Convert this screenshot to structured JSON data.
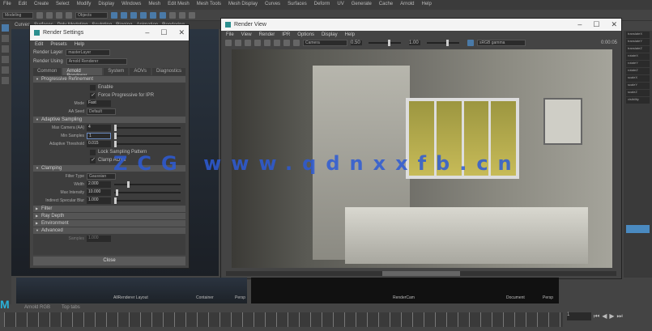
{
  "menubar": [
    "File",
    "Edit",
    "Create",
    "Select",
    "Modify",
    "Display",
    "Windows",
    "Mesh",
    "Edit Mesh",
    "Mesh Tools",
    "Mesh Display",
    "Curves",
    "Surfaces",
    "Deform",
    "UV",
    "Generate",
    "Cache",
    "Arnold",
    "Help"
  ],
  "workspace": "Modeling",
  "search": "Objects",
  "shelf_tabs": [
    "Curves",
    "Surfaces",
    "Poly Modeling",
    "Sculpting",
    "Rigging",
    "Animation",
    "Rendering"
  ],
  "render_settings": {
    "title": "Render Settings",
    "menu": [
      "Edit",
      "Presets",
      "Help"
    ],
    "render_layer_label": "Render Layer",
    "render_layer": "masterLayer",
    "render_using_label": "Render Using",
    "render_using": "Arnold Renderer",
    "tabs": [
      "Common",
      "Arnold Renderer",
      "System",
      "AOVs",
      "Diagnostics"
    ],
    "active_tab": 1,
    "sections": {
      "progressive": "Progressive Refinement",
      "adaptive": "Adaptive Sampling",
      "clamping": "Clamping",
      "filter": "Filter",
      "advanced": "Advanced",
      "ray_depth": "Ray Depth",
      "environment": "Environment"
    },
    "fields": {
      "enable": "Enable",
      "progressive": "Force Progressive for IPR",
      "mode": "Mode",
      "mode_val": "Fast",
      "aa_pattern": "AA Seed",
      "aa_pattern_val": "Default",
      "max_camera": "Max Camera (AA)",
      "max_camera_val": "4",
      "adaptive_threshold": "Adaptive Threshold",
      "adaptive_threshold_val": "0.015",
      "min_samples": "Min Samples",
      "min_samples_val": "1",
      "lock_sampling": "Lock Sampling Pattern",
      "clamp_aovs": "Clamp AOVs",
      "filter_type": "Filter Type",
      "filter_type_val": "Gaussian",
      "width": "Width",
      "width_val": "2.000",
      "max_intensity": "Max Intensity",
      "max_intensity_val": "10.000",
      "indirect_specular": "Indirect Specular Blur",
      "indirect_specular_val": "1.000",
      "samples": "Samples",
      "samples_val": "1.000"
    },
    "close": "Close"
  },
  "render_view": {
    "title": "Render View",
    "menu": [
      "File",
      "View",
      "Render",
      "IPR",
      "Options",
      "Display",
      "Help"
    ],
    "camera": "Camera",
    "zoom1": "0.50",
    "zoom2": "1.00",
    "display": "sRGB gamma",
    "time": "0:00:05"
  },
  "watermark": "ZCG www.qdnxxfb.cn",
  "panels": [
    {
      "name": "persp",
      "labels": [
        "AllRenderer Layout",
        "Container",
        "Persp"
      ]
    },
    {
      "name": "camera",
      "labels": [
        "RenderCam",
        "Document",
        "Persp"
      ]
    }
  ],
  "status": [
    "Arnold RGB",
    "Top tabs"
  ],
  "channel_box": [
    "translateX",
    "translateY",
    "translateZ",
    "rotateX",
    "rotateY",
    "rotateZ",
    "scaleX",
    "scaleY",
    "scaleZ",
    "visibility"
  ],
  "frame": "1"
}
